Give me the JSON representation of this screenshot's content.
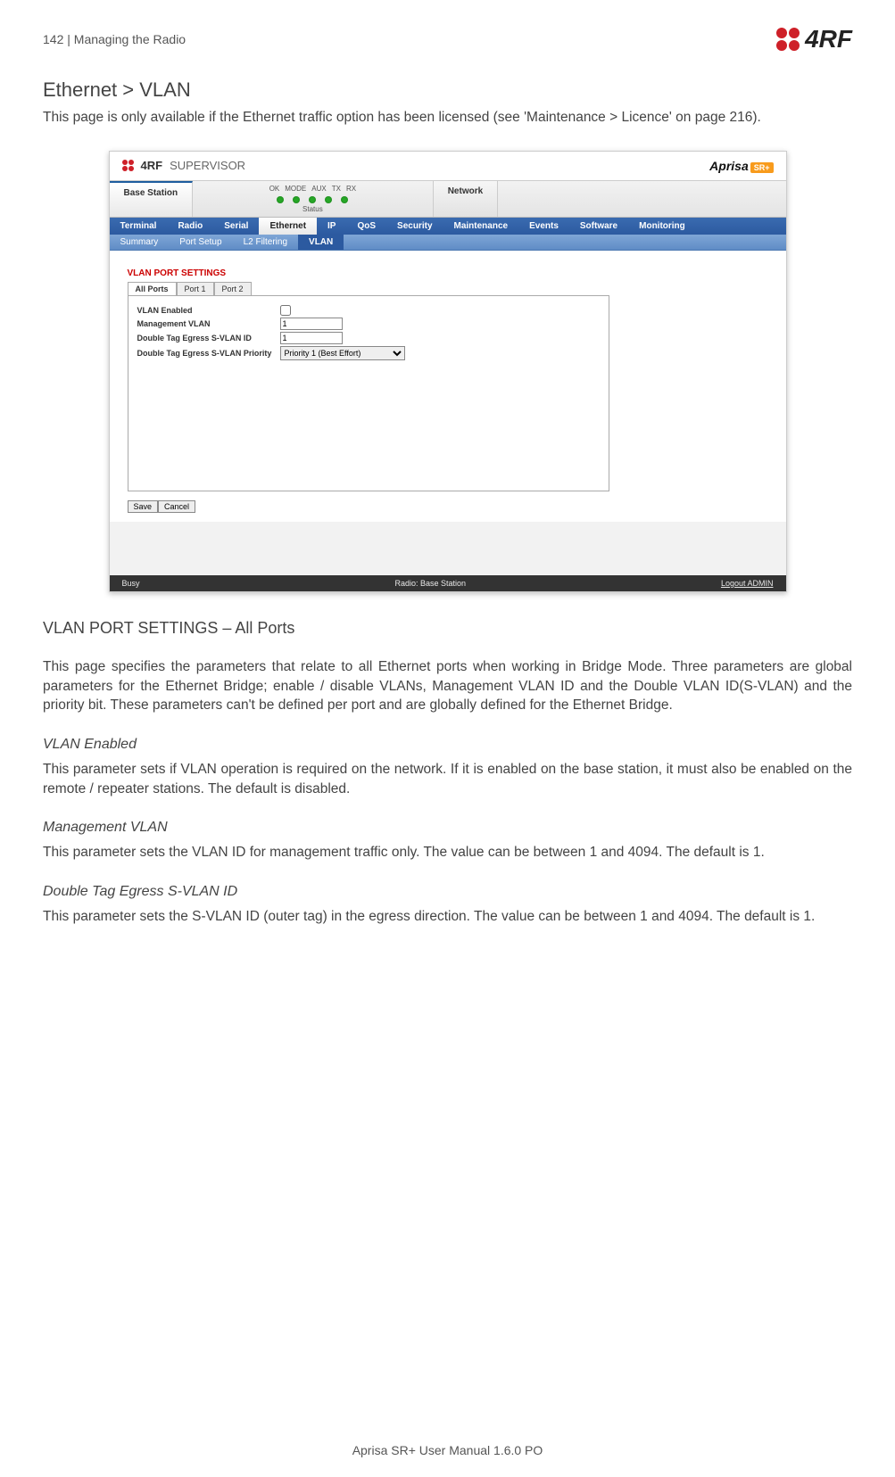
{
  "header": {
    "page_num": "142",
    "chapter": "Managing the Radio",
    "logo_text": "4RF"
  },
  "title": "Ethernet > VLAN",
  "intro": "This page is only available if the Ethernet traffic option has been licensed (see 'Maintenance > Licence' on page 216).",
  "screenshot": {
    "brand_prefix": "4RF",
    "brand_label": "SUPERVISOR",
    "aprisa_brand": "Aprisa",
    "aprisa_badge": "SR+",
    "tab_base": "Base Station",
    "tab_network": "Network",
    "led_labels": [
      "OK",
      "MODE",
      "AUX",
      "TX",
      "RX"
    ],
    "status_label": "Status",
    "nav1": [
      "Terminal",
      "Radio",
      "Serial",
      "Ethernet",
      "IP",
      "QoS",
      "Security",
      "Maintenance",
      "Events",
      "Software",
      "Monitoring"
    ],
    "nav1_active_index": 3,
    "nav2": [
      "Summary",
      "Port Setup",
      "L2 Filtering",
      "VLAN"
    ],
    "nav2_active_index": 3,
    "section_title": "VLAN PORT SETTINGS",
    "subtabs": [
      "All Ports",
      "Port 1",
      "Port 2"
    ],
    "subtabs_active_index": 0,
    "form": {
      "vlan_enabled_label": "VLAN Enabled",
      "vlan_enabled_value": false,
      "mgmt_vlan_label": "Management VLAN",
      "mgmt_vlan_value": "1",
      "double_tag_id_label": "Double Tag Egress S-VLAN ID",
      "double_tag_id_value": "1",
      "double_tag_pri_label": "Double Tag Egress S-VLAN Priority",
      "double_tag_pri_value": "Priority 1 (Best Effort)"
    },
    "buttons": {
      "save": "Save",
      "cancel": "Cancel"
    },
    "footer": {
      "left": "Busy",
      "center": "Radio: Base Station",
      "right": "Logout ADMIN"
    }
  },
  "section_heading": "VLAN PORT SETTINGS – All Ports",
  "para_ports": "This page specifies the parameters that relate to all Ethernet ports when working in Bridge Mode. Three parameters are global parameters for the Ethernet Bridge; enable / disable VLANs, Management VLAN ID and the Double VLAN ID(S-VLAN) and the priority bit. These parameters can't be defined per port and are globally defined for the Ethernet Bridge.",
  "sub1_title": "VLAN Enabled",
  "sub1_body": "This parameter sets if VLAN operation is required on the network. If it is enabled on the base station, it must also be enabled on the remote / repeater stations. The default is disabled.",
  "sub2_title": "Management VLAN",
  "sub2_body": "This parameter sets the VLAN ID for management traffic only. The value can be between 1 and 4094. The default is 1.",
  "sub3_title": "Double Tag Egress S-VLAN ID",
  "sub3_body": "This parameter sets the S-VLAN ID (outer tag) in the egress direction. The value can be between 1 and 4094. The default is 1.",
  "footer_text": "Aprisa SR+ User Manual 1.6.0 PO"
}
